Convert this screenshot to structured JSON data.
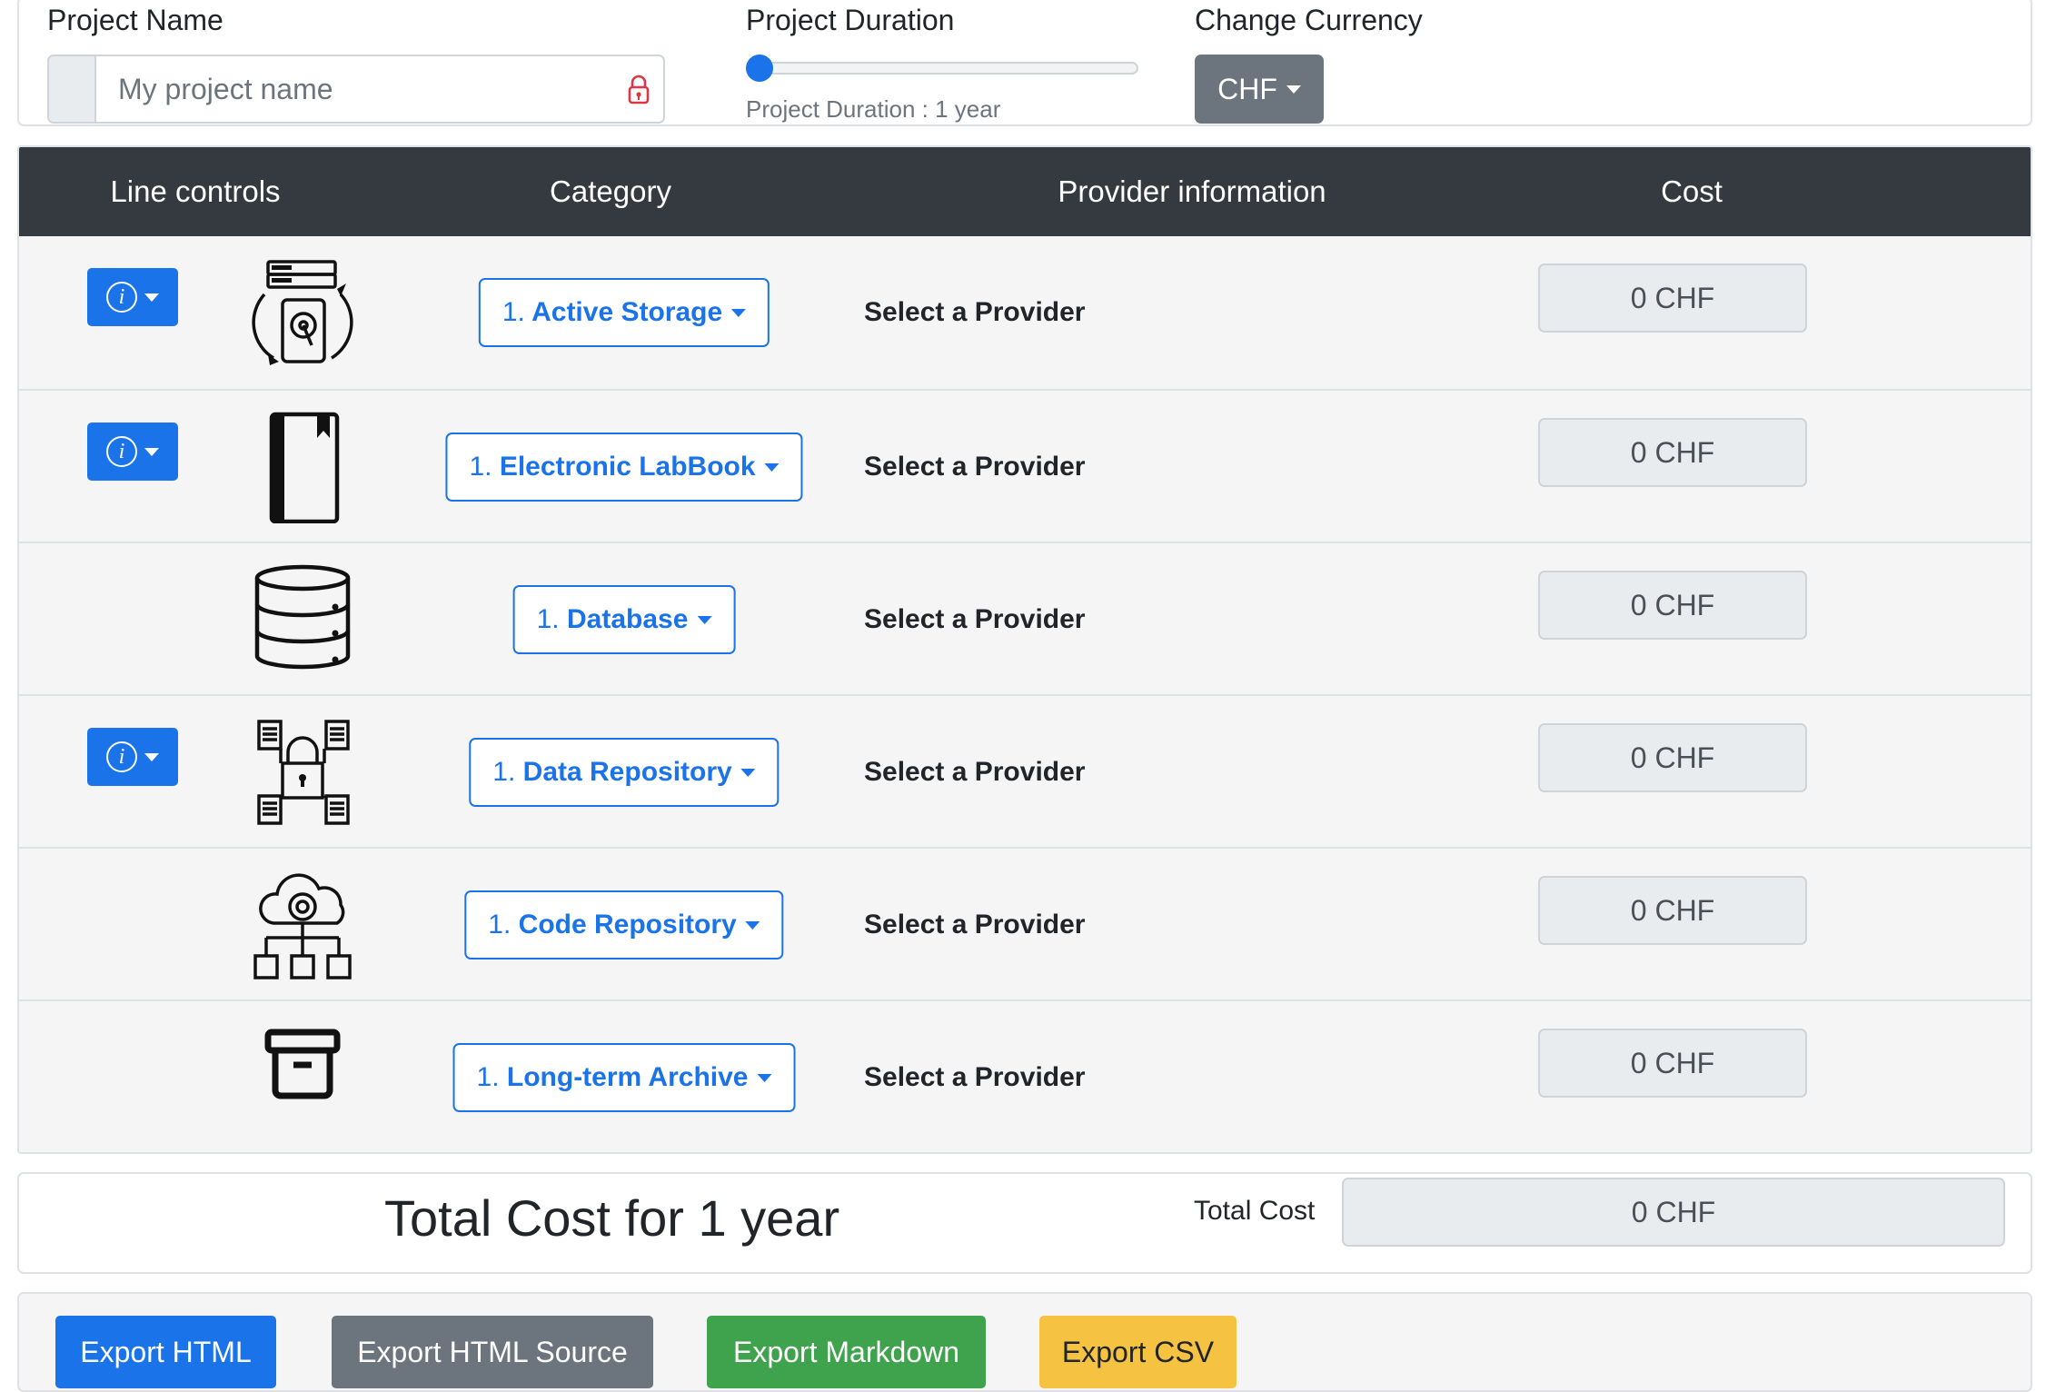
{
  "project": {
    "name_label": "Project Name",
    "name_placeholder": "My project name",
    "name_value": "",
    "duration_label": "Project Duration",
    "duration_note": "Project Duration : 1 year",
    "duration_level": 0,
    "currency_label": "Change Currency",
    "currency_value": "CHF"
  },
  "table": {
    "headers": [
      "Line controls",
      "Category",
      "Provider information",
      "Cost"
    ],
    "rows": [
      {
        "icon": "storage-icon",
        "has_info": true,
        "num": "1.",
        "category": "Active Storage",
        "provider": "Select a Provider",
        "cost": "0 CHF"
      },
      {
        "icon": "labbook-icon",
        "has_info": true,
        "num": "1.",
        "category": "Electronic LabBook",
        "provider": "Select a Provider",
        "cost": "0 CHF"
      },
      {
        "icon": "database-icon",
        "has_info": false,
        "num": "1.",
        "category": "Database",
        "provider": "Select a Provider",
        "cost": "0 CHF"
      },
      {
        "icon": "data-repository-icon",
        "has_info": true,
        "num": "1.",
        "category": "Data Repository",
        "provider": "Select a Provider",
        "cost": "0 CHF"
      },
      {
        "icon": "code-repository-icon",
        "has_info": false,
        "num": "1.",
        "category": "Code Repository",
        "provider": "Select a Provider",
        "cost": "0 CHF"
      },
      {
        "icon": "archive-icon",
        "has_info": false,
        "num": "1.",
        "category": "Long-term Archive",
        "provider": "Select a Provider",
        "cost": "0 CHF"
      }
    ]
  },
  "total": {
    "title": "Total Cost for 1 year",
    "label": "Total Cost",
    "value": "0 CHF"
  },
  "export": {
    "html": "Export HTML",
    "source": "Export HTML Source",
    "markdown": "Export Markdown",
    "csv": "Export CSV"
  },
  "colors": {
    "primary": "#1a73e8",
    "secondary": "#6c757d",
    "success": "#3fa34d",
    "warning": "#f5c242",
    "dark": "#343a40"
  }
}
